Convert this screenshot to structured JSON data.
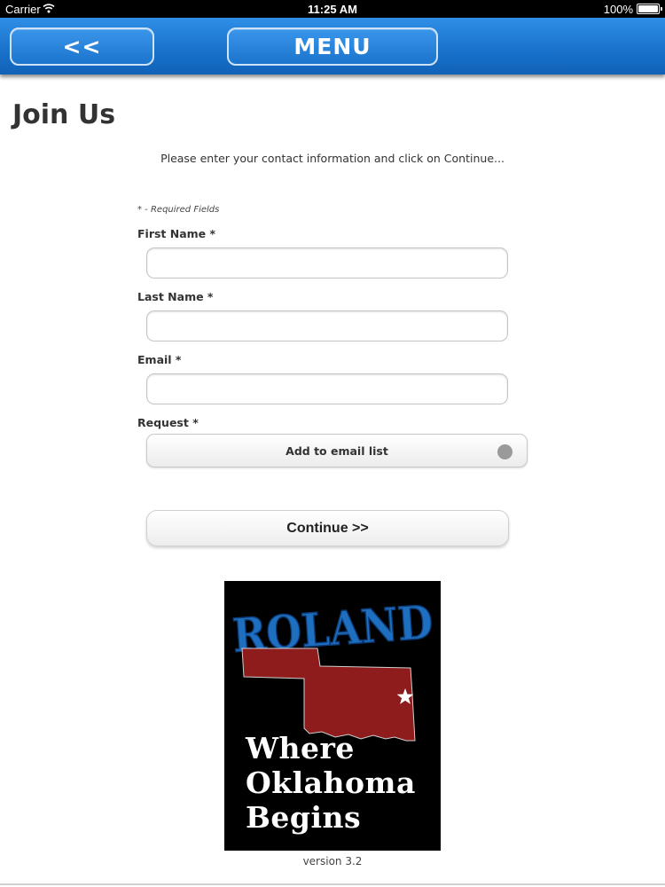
{
  "status_bar": {
    "carrier": "Carrier",
    "time": "11:25 AM",
    "battery": "100%"
  },
  "nav": {
    "back_label": "<<",
    "menu_label": "MENU",
    "accent_color": "#1a73cc"
  },
  "page": {
    "title": "Join Us",
    "instructions": "Please enter your contact information and click on Continue..."
  },
  "form": {
    "required_note": "* - Required Fields",
    "first_name": {
      "label": "First Name *",
      "value": ""
    },
    "last_name": {
      "label": "Last Name *",
      "value": ""
    },
    "email": {
      "label": "Email *",
      "value": ""
    },
    "request": {
      "label": "Request *",
      "selected": "Add to email list"
    },
    "continue_label": "Continue >>"
  },
  "logo": {
    "title": "ROLAND",
    "line1": "Where",
    "line2": "Oklahoma",
    "line3": "Begins",
    "title_color": "#1f6fc0",
    "state_color": "#8e1c1c"
  },
  "footer": {
    "version": "version 3.2"
  }
}
